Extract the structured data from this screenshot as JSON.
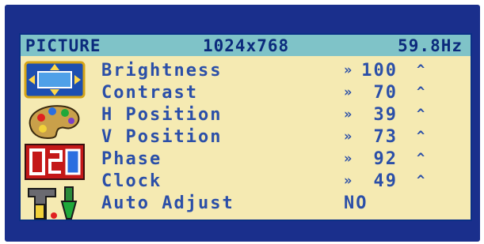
{
  "header": {
    "title": "PICTURE",
    "resolution": "1024x768",
    "frequency": "59.8Hz"
  },
  "icons": [
    {
      "name": "picture-position-icon"
    },
    {
      "name": "color-palette-icon"
    },
    {
      "name": "osd-icon"
    },
    {
      "name": "tools-icon"
    }
  ],
  "settings": [
    {
      "label": "Brightness",
      "value": "100"
    },
    {
      "label": "Contrast",
      "value": "70"
    },
    {
      "label": "H Position",
      "value": "39"
    },
    {
      "label": "V Position",
      "value": "73"
    },
    {
      "label": "Phase",
      "value": "92"
    },
    {
      "label": "Clock",
      "value": "49"
    }
  ],
  "auto_adjust": {
    "label": "Auto Adjust",
    "value": "NO"
  },
  "arrows": {
    "down": "»",
    "up": "^"
  },
  "colors": {
    "bezel": "#1a2f8c",
    "panel": "#f5eab2",
    "header": "#7fc3c8",
    "text": "#2b4fa8"
  }
}
